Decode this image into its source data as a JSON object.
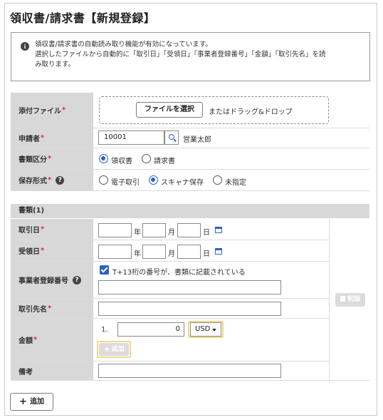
{
  "page": {
    "title": "領収書/請求書【新規登録】"
  },
  "info": {
    "lines": [
      "領収書/請求書の自動読み取り機能が有効になっています。",
      "選択したファイルから自動的に「取引日」「受領日」「事業者登録番号」「金額」「取引先名」を読",
      "み取ります。"
    ]
  },
  "form": {
    "attachment": {
      "label": "添付ファイル",
      "required_mark": "*",
      "button": "ファイルを選択",
      "drop_text": "またはドラッグ&ドロップ"
    },
    "applicant": {
      "label": "申請者",
      "required_mark": "*",
      "id_value": "10001",
      "name": "営業太郎"
    },
    "doc_type": {
      "label": "書類区分",
      "required_mark": "*",
      "options": [
        "領収書",
        "請求書"
      ],
      "selected": "領収書"
    },
    "storage": {
      "label": "保存形式",
      "required_mark": "*",
      "options": [
        "電子取引",
        "スキャナ保存",
        "未指定"
      ],
      "selected": "スキャナ保存"
    }
  },
  "document_section": {
    "header": "書類(1)",
    "transaction_date": {
      "label": "取引日",
      "required_mark": "*",
      "year": "年",
      "month": "月",
      "day": "日"
    },
    "receipt_date": {
      "label": "受領日",
      "required_mark": "*",
      "year": "年",
      "month": "月",
      "day": "日"
    },
    "registration_number": {
      "label": "事業者登録番号",
      "checkbox_label": "T+13桁の番号が、書類に記載されている",
      "checked": true
    },
    "partner": {
      "label": "取引先名",
      "required_mark": "*"
    },
    "amount": {
      "label": "金額",
      "required_mark": "*",
      "index": "1.",
      "value": "0",
      "currency": "USD",
      "add_button": "追加"
    },
    "remarks": {
      "label": "備考"
    },
    "delete_button": "削除"
  },
  "footer": {
    "add_button": "追加"
  },
  "colors": {
    "accent": "#2c61c6",
    "required": "#d9302c",
    "label_bg": "#d8d8d8",
    "highlight": "#f2d98a"
  }
}
